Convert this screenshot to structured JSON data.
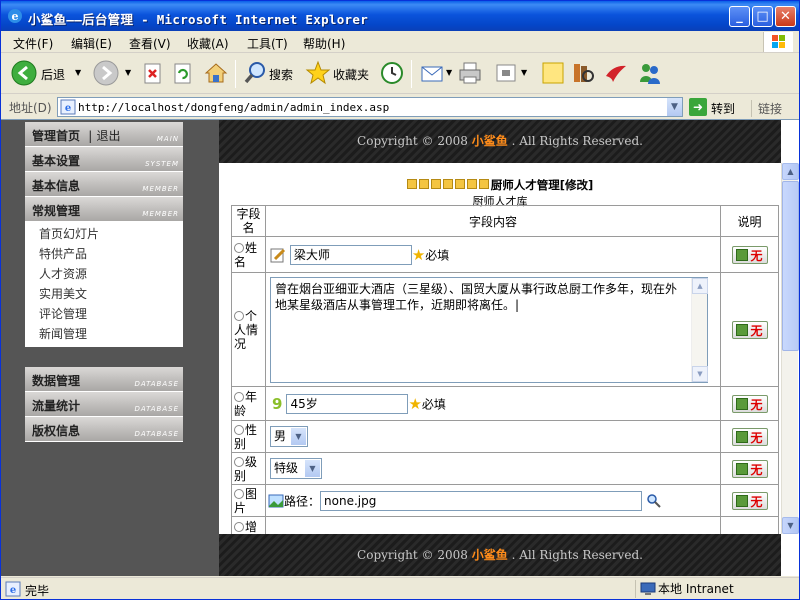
{
  "window": {
    "title": "小鲨鱼——后台管理 - Microsoft Internet Explorer",
    "minimize": "_",
    "maximize": "□",
    "close": "✕"
  },
  "menu": [
    "文件(F)",
    "编辑(E)",
    "查看(V)",
    "收藏(A)",
    "工具(T)",
    "帮助(H)"
  ],
  "toolbar": {
    "back": "后退",
    "search": "搜索",
    "favorites": "收藏夹"
  },
  "address": {
    "label": "地址(D)",
    "url": "http://localhost/dongfeng/admin/admin_index.asp",
    "go": "转到",
    "links": "链接"
  },
  "nav": {
    "home": "管理首页",
    "logout": "退出",
    "home_en": "MAIN",
    "sections": [
      {
        "title": "基本设置",
        "en": "SYSTEM"
      },
      {
        "title": "基本信息",
        "en": "MEMBER"
      },
      {
        "title": "常规管理",
        "en": "MEMBER"
      }
    ],
    "items": [
      "首页幻灯片",
      "特供产品",
      "人才资源",
      "实用美文",
      "评论管理",
      "新闻管理"
    ],
    "lower": [
      {
        "title": "数据管理",
        "en": "DATABASE"
      },
      {
        "title": "流量统计",
        "en": "DATABASE"
      },
      {
        "title": "版权信息",
        "en": "DATABASE"
      }
    ]
  },
  "banner": {
    "prefix": "Copyright © 2008",
    "brand": "小鲨鱼",
    "suffix": ". All Rights Reserved."
  },
  "form": {
    "heading": "厨师人才管理[修改]",
    "subheading": "厨师人才库",
    "col_field": "字段名",
    "col_content": "字段内容",
    "col_desc": "说明",
    "rows": {
      "name_label": "姓名",
      "name_value": "梁大师",
      "required": "必填",
      "bio_label": "个人情况",
      "bio_value": "曾在烟台亚细亚大酒店（三星级）、国贸大厦从事行政总厨工作多年，现在外地某星级酒店从事管理工作，近期即将离任。",
      "age_label": "年龄",
      "age_value": "45岁",
      "gender_label": "性别",
      "gender_value": "男",
      "level_label": "级别",
      "level_value": "特级",
      "image_label": "图片",
      "path_label": "路径：",
      "path_value": "none.jpg",
      "next_label": "增"
    }
  },
  "status": {
    "text": "完毕",
    "zone": "本地 Intranet"
  },
  "colors": {
    "title_bar": "#0a5fe8",
    "nav_bg": "#555555",
    "banner_accent": "#ff8c1a"
  }
}
